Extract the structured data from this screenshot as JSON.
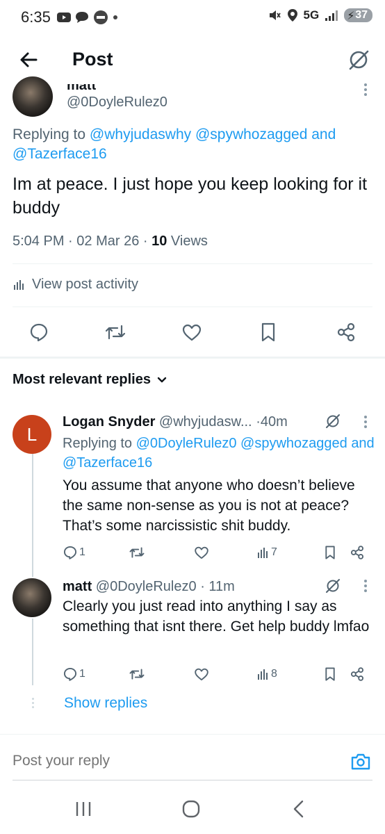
{
  "status_bar": {
    "time": "6:35",
    "network": "5G",
    "battery": "37"
  },
  "header": {
    "title": "Post"
  },
  "main_post": {
    "name": "matt",
    "handle": "@0DoyleRulez0",
    "replying_prefix": "Replying to",
    "replying_to": [
      "@whyjudaswhy",
      "@spywhozagged",
      "and",
      "@Tazerface16"
    ],
    "text": "Im at peace. I just hope you keep looking for it buddy",
    "time": "5:04 PM",
    "date": "02 Mar 26",
    "views_count": "10",
    "views_label": "Views",
    "activity_label": "View post activity"
  },
  "replies_section": {
    "sort_label": "Most relevant replies"
  },
  "replies": [
    {
      "avatar_letter": "L",
      "avatar_color": "#c8411b",
      "name": "Logan Snyder",
      "handle": "@whyjudasw...",
      "age": "40m",
      "replying_prefix": "Replying to",
      "replying_to": [
        "@0DoyleRulez0",
        "@spywhozagged",
        "and",
        "@Tazerface16"
      ],
      "text": "You assume that anyone who doesn’t believe the same non-sense as you is not at peace? That’s some narcissistic shit buddy.",
      "reply_count": "1",
      "view_count": "7"
    },
    {
      "name": "matt",
      "handle": "@0DoyleRulez0",
      "age": "11m",
      "text": "Clearly you just read into anything I say as something that isnt there. Get help buddy lmfao",
      "reply_count": "1",
      "view_count": "8"
    }
  ],
  "show_replies_label": "Show replies",
  "composer": {
    "placeholder": "Post your reply"
  },
  "colors": {
    "accent": "#1d9bf0",
    "text": "#0f1419",
    "muted": "#536471"
  }
}
